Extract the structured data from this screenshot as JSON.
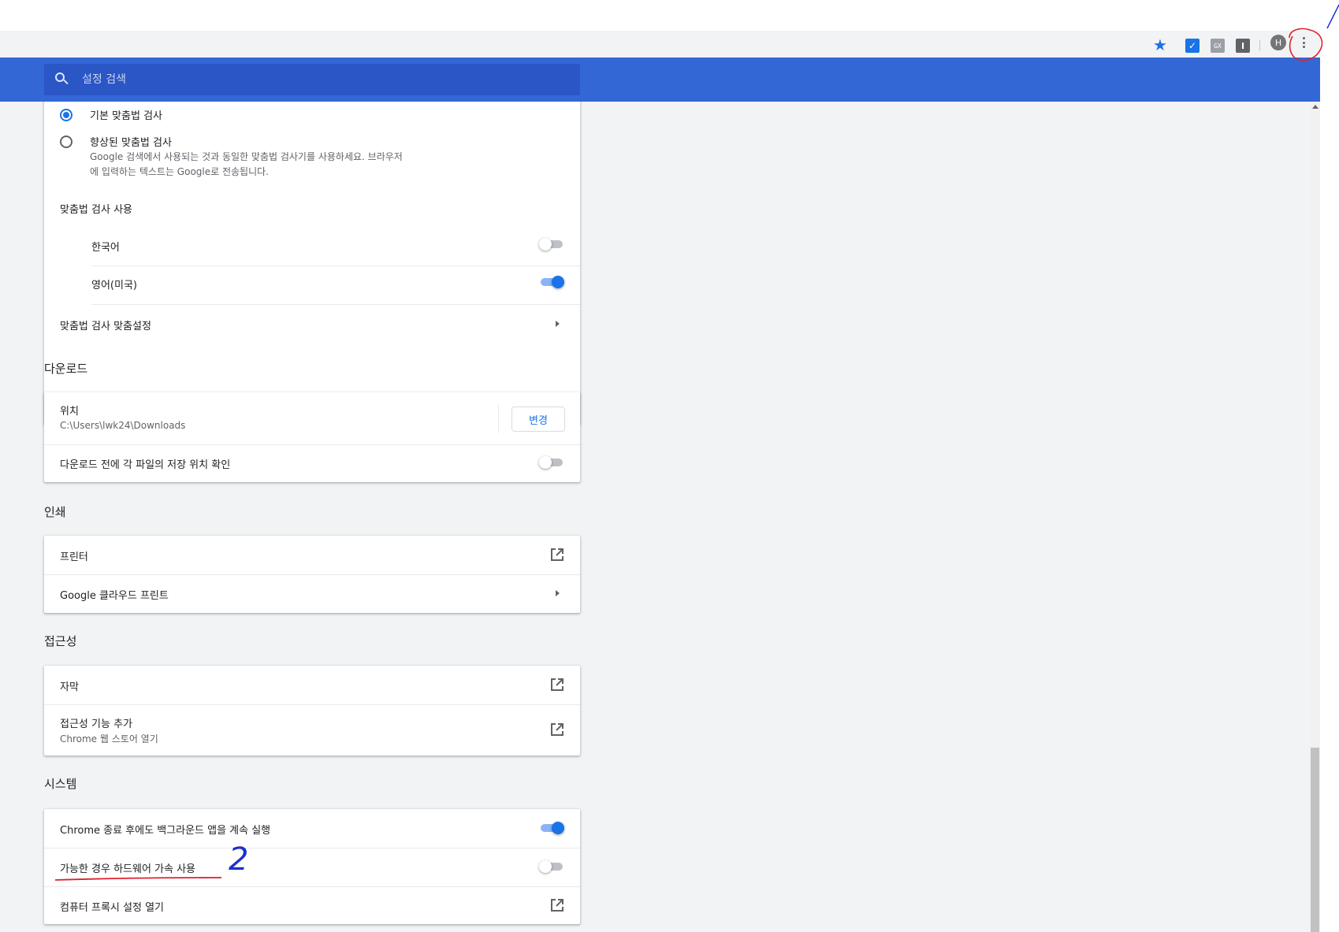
{
  "toolbar": {
    "icons": [
      "star-icon",
      "extension-checkbox-icon",
      "extension-gray-icon",
      "extension-dark-icon"
    ],
    "ext2_label": "GX",
    "ext3_label": "I",
    "avatar_letter": "H",
    "menu_icon": "three-dot-vertical-icon"
  },
  "header": {
    "search_placeholder": "설정 검색",
    "accent_color": "#3367d6"
  },
  "spellcheck": {
    "basic_label": "기본 맞춤법 검사",
    "enhanced_label": "향상된 맞춤법 검사",
    "enhanced_desc_line1": "Google 검색에서 사용되는 것과 동일한 맞춤법 검사기를 사용하세요. 브라우저",
    "enhanced_desc_line2": "에 입력하는 텍스트는 Google로 전송됩니다.",
    "use_label": "맞춤법 검사 사용",
    "languages": [
      {
        "label": "한국어",
        "enabled": false
      },
      {
        "label": "영어(미국)",
        "enabled": true
      }
    ],
    "custom_label": "맞춤법 검사 맞춤설정"
  },
  "downloads": {
    "title": "다운로드",
    "location_label": "위치",
    "location_value": "C:\\Users\\lwk24\\Downloads",
    "change_button": "변경",
    "ask_label": "다운로드 전에 각 파일의 저장 위치 확인",
    "ask_enabled": false
  },
  "printing": {
    "title": "인쇄",
    "printers_label": "프린터",
    "cloud_print_label": "Google 클라우드 프린트"
  },
  "accessibility": {
    "title": "접근성",
    "captions_label": "자막",
    "add_features_label": "접근성 기능 추가",
    "add_features_sub": "Chrome 웹 스토어 열기"
  },
  "system": {
    "title": "시스템",
    "background_label": "Chrome 종료 후에도 백그라운드 앱을 계속 실행",
    "background_enabled": true,
    "hw_accel_label": "가능한 경우 하드웨어 가속 사용",
    "hw_accel_enabled": false,
    "proxy_label": "컴퓨터 프록시 설정 열기"
  },
  "annotations": {
    "handwritten_number": "2"
  }
}
